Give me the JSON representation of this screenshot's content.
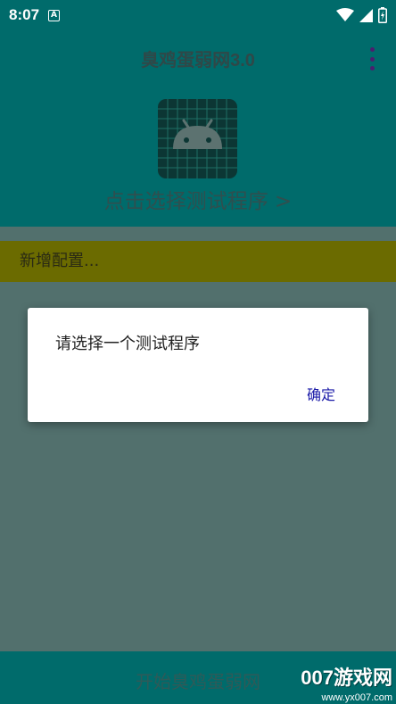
{
  "status_bar": {
    "time": "8:07",
    "notification_letter": "A"
  },
  "app_bar": {
    "title": "臭鸡蛋弱网3.0"
  },
  "header": {
    "select_program_link": "点击选择测试程序 >",
    "icon": "android-icon"
  },
  "config": {
    "new_config_label": "新增配置..."
  },
  "dialog": {
    "message": "请选择一个测试程序",
    "confirm_label": "确定"
  },
  "bottom": {
    "start_button_label": "开始臭鸡蛋弱网"
  },
  "watermark": {
    "main": "007游戏网",
    "url": "www.yx007.com"
  },
  "colors": {
    "primary": "#006b6b",
    "accent_bar": "#6b6b00",
    "dialog_button": "#1a1aa8",
    "overflow_dots": "#4a1f6e"
  }
}
